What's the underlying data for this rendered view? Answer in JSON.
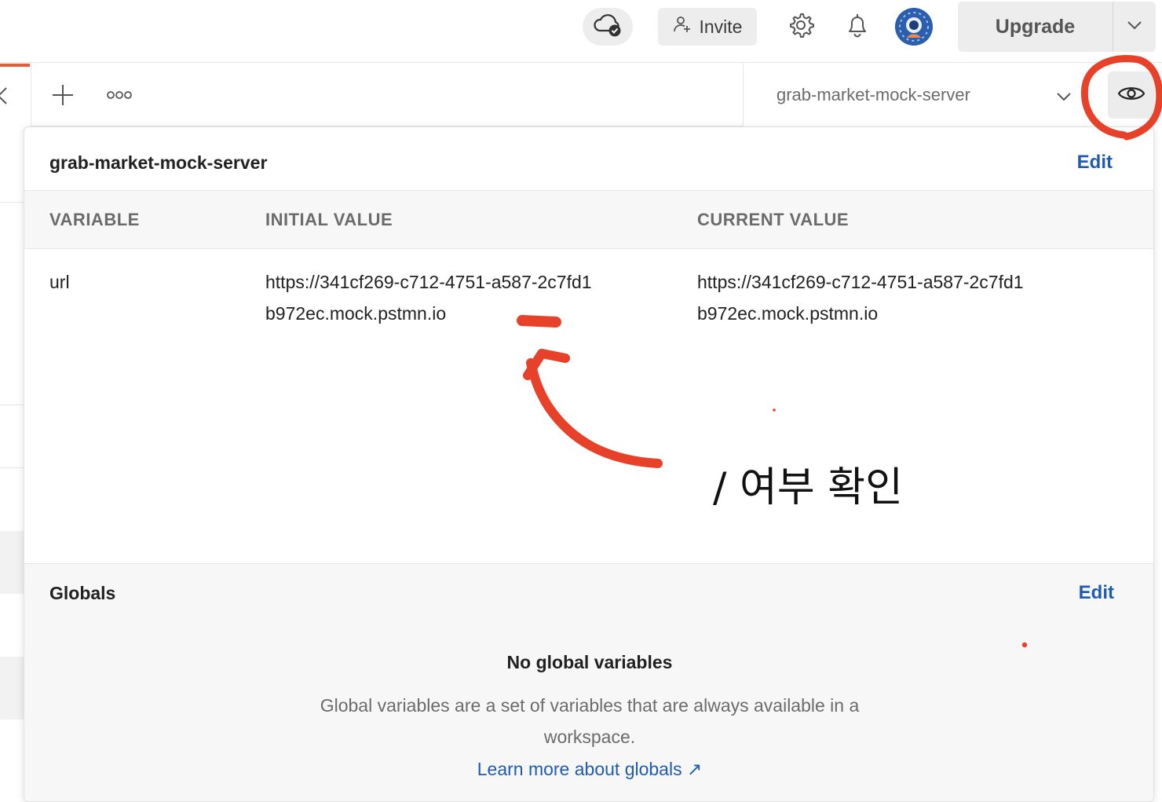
{
  "header": {
    "invite_label": "Invite",
    "upgrade_label": "Upgrade"
  },
  "environment": {
    "selected_name": "grab-market-mock-server",
    "section_title": "grab-market-mock-server",
    "edit_label": "Edit",
    "columns": [
      "VARIABLE",
      "INITIAL VALUE",
      "CURRENT VALUE"
    ],
    "variables": [
      {
        "name": "url",
        "initial_value": "https://341cf269-c712-4751-a587-2c7fd1b972ec.mock.pstmn.io",
        "current_value": "https://341cf269-c712-4751-a587-2c7fd1b972ec.mock.pstmn.io"
      }
    ]
  },
  "globals": {
    "title": "Globals",
    "edit_label": "Edit",
    "empty_title": "No global variables",
    "empty_description": "Global variables are a set of variables that are always available in a workspace.",
    "learn_more_label": "Learn more about globals ↗"
  },
  "annotation": {
    "note": "/ 여부 확인",
    "color": "#e8412a"
  },
  "icons": [
    "cloud-sync-icon",
    "add-user-icon",
    "gear-icon",
    "bell-icon",
    "avatar",
    "chevron-down-icon",
    "collapse-icon",
    "plus-icon",
    "more-icon",
    "eye-icon"
  ]
}
